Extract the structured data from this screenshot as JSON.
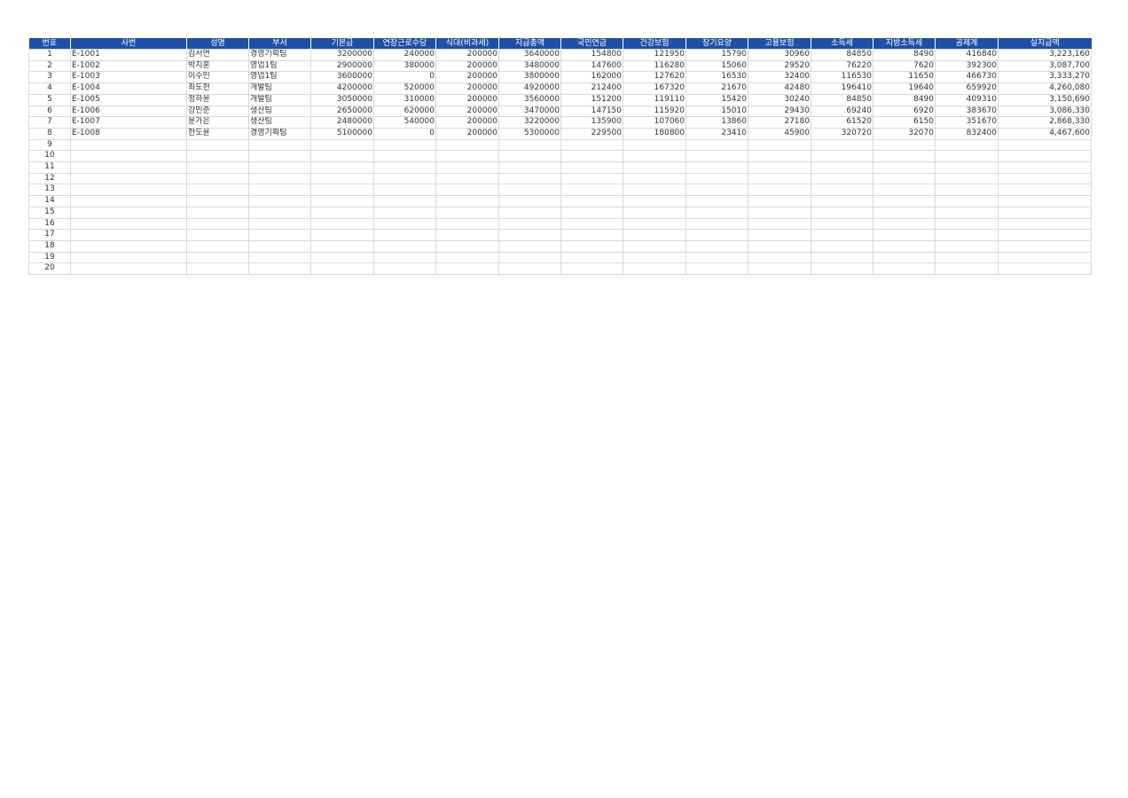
{
  "colors": {
    "header_bg": "#1f4fa8",
    "header_text": "#ffffff",
    "grid_line": "#d5d8de",
    "cell_text": "#333333"
  },
  "table": {
    "columns": [
      {
        "key": "no",
        "label": "번호",
        "align": "center"
      },
      {
        "key": "emp_id",
        "label": "사번",
        "align": "left"
      },
      {
        "key": "name",
        "label": "성명",
        "align": "left"
      },
      {
        "key": "dept",
        "label": "부서",
        "align": "left"
      },
      {
        "key": "base_pay",
        "label": "기본급",
        "align": "right"
      },
      {
        "key": "overtime",
        "label": "연장근로수당",
        "align": "right"
      },
      {
        "key": "meal",
        "label": "식대(비과세)",
        "align": "right"
      },
      {
        "key": "gross",
        "label": "지급총액",
        "align": "right"
      },
      {
        "key": "pension",
        "label": "국민연금",
        "align": "right"
      },
      {
        "key": "health",
        "label": "건강보험",
        "align": "right"
      },
      {
        "key": "ltc",
        "label": "장기요양",
        "align": "right"
      },
      {
        "key": "employment",
        "label": "고용보험",
        "align": "right"
      },
      {
        "key": "income_tax",
        "label": "소득세",
        "align": "right"
      },
      {
        "key": "local_tax",
        "label": "지방소득세",
        "align": "right"
      },
      {
        "key": "deduction_total",
        "label": "공제계",
        "align": "right"
      },
      {
        "key": "net_pay",
        "label": "실지급액",
        "align": "right"
      }
    ],
    "rows": [
      [
        "1",
        "E-1001",
        "김서연",
        "경영기획팀",
        "3200000",
        "240000",
        "200000",
        "3640000",
        "154800",
        "121950",
        "15790",
        "30960",
        "84850",
        "8490",
        "416840",
        "3,223,160"
      ],
      [
        "2",
        "E-1002",
        "박지훈",
        "영업1팀",
        "2900000",
        "380000",
        "200000",
        "3480000",
        "147600",
        "116280",
        "15060",
        "29520",
        "76220",
        "7620",
        "392300",
        "3,087,700"
      ],
      [
        "3",
        "E-1003",
        "이수민",
        "영업1팀",
        "3600000",
        "0",
        "200000",
        "3800000",
        "162000",
        "127620",
        "16530",
        "32400",
        "116530",
        "11650",
        "466730",
        "3,333,270"
      ],
      [
        "4",
        "E-1004",
        "최도현",
        "개발팀",
        "4200000",
        "520000",
        "200000",
        "4920000",
        "212400",
        "167320",
        "21670",
        "42480",
        "196410",
        "19640",
        "659920",
        "4,260,080"
      ],
      [
        "5",
        "E-1005",
        "정하윤",
        "개발팀",
        "3050000",
        "310000",
        "200000",
        "3560000",
        "151200",
        "119110",
        "15420",
        "30240",
        "84850",
        "8490",
        "409310",
        "3,150,690"
      ],
      [
        "6",
        "E-1006",
        "강민준",
        "생산팀",
        "2650000",
        "620000",
        "200000",
        "3470000",
        "147150",
        "115920",
        "15010",
        "29430",
        "69240",
        "6920",
        "383670",
        "3,086,330"
      ],
      [
        "7",
        "E-1007",
        "윤가은",
        "생산팀",
        "2480000",
        "540000",
        "200000",
        "3220000",
        "135900",
        "107060",
        "13860",
        "27180",
        "61520",
        "6150",
        "351670",
        "2,868,330"
      ],
      [
        "8",
        "E-1008",
        "한도윤",
        "경영기획팀",
        "5100000",
        "0",
        "200000",
        "5300000",
        "229500",
        "180800",
        "23410",
        "45900",
        "320720",
        "32070",
        "832400",
        "4,467,600"
      ],
      [
        "9",
        "",
        "",
        "",
        "",
        "",
        "",
        "",
        "",
        "",
        "",
        "",
        "",
        "",
        "",
        ""
      ],
      [
        "10",
        "",
        "",
        "",
        "",
        "",
        "",
        "",
        "",
        "",
        "",
        "",
        "",
        "",
        "",
        ""
      ],
      [
        "11",
        "",
        "",
        "",
        "",
        "",
        "",
        "",
        "",
        "",
        "",
        "",
        "",
        "",
        "",
        ""
      ],
      [
        "12",
        "",
        "",
        "",
        "",
        "",
        "",
        "",
        "",
        "",
        "",
        "",
        "",
        "",
        "",
        ""
      ],
      [
        "13",
        "",
        "",
        "",
        "",
        "",
        "",
        "",
        "",
        "",
        "",
        "",
        "",
        "",
        "",
        ""
      ],
      [
        "14",
        "",
        "",
        "",
        "",
        "",
        "",
        "",
        "",
        "",
        "",
        "",
        "",
        "",
        "",
        ""
      ],
      [
        "15",
        "",
        "",
        "",
        "",
        "",
        "",
        "",
        "",
        "",
        "",
        "",
        "",
        "",
        "",
        ""
      ],
      [
        "16",
        "",
        "",
        "",
        "",
        "",
        "",
        "",
        "",
        "",
        "",
        "",
        "",
        "",
        "",
        ""
      ],
      [
        "17",
        "",
        "",
        "",
        "",
        "",
        "",
        "",
        "",
        "",
        "",
        "",
        "",
        "",
        "",
        ""
      ],
      [
        "18",
        "",
        "",
        "",
        "",
        "",
        "",
        "",
        "",
        "",
        "",
        "",
        "",
        "",
        "",
        ""
      ],
      [
        "19",
        "",
        "",
        "",
        "",
        "",
        "",
        "",
        "",
        "",
        "",
        "",
        "",
        "",
        "",
        ""
      ],
      [
        "20",
        "",
        "",
        "",
        "",
        "",
        "",
        "",
        "",
        "",
        "",
        "",
        "",
        "",
        "",
        ""
      ]
    ]
  }
}
